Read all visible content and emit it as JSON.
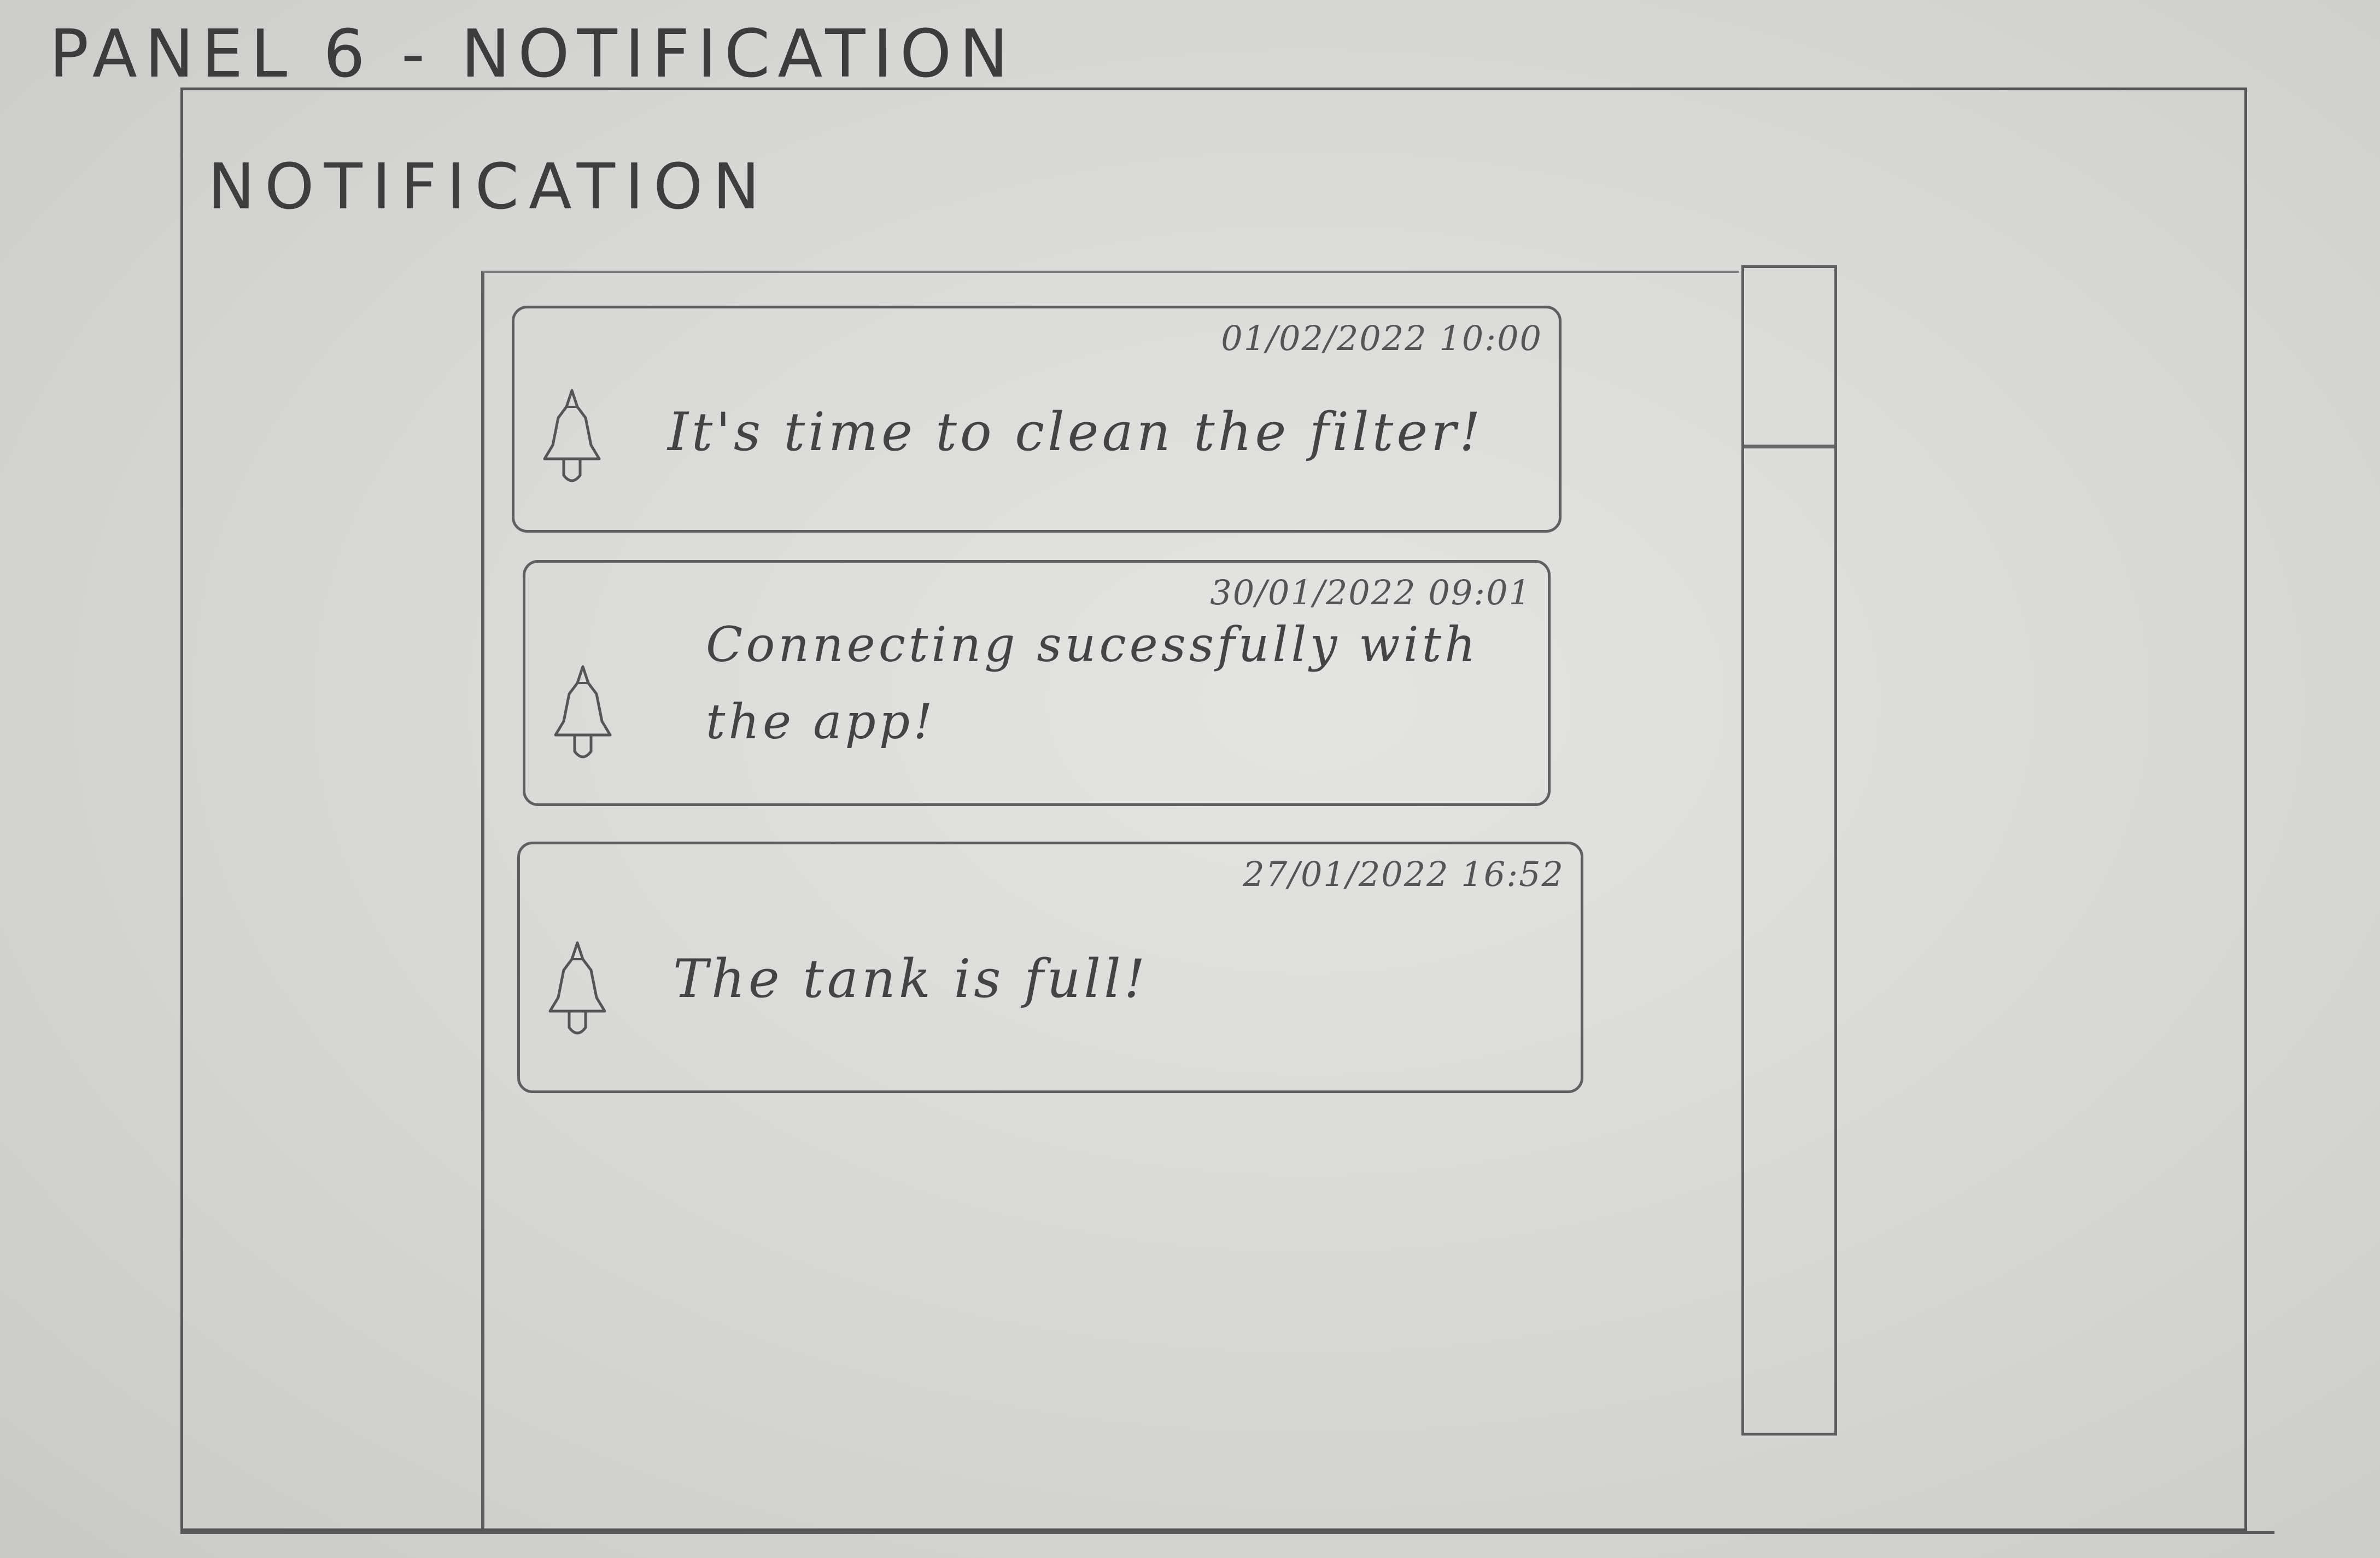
{
  "sketch_title": "PANEL 6 - NOTIFICATION",
  "panel": {
    "heading": "NOTIFICATION"
  },
  "notifications": [
    {
      "timestamp": "01/02/2022 10:00",
      "message": "It's time to clean the filter!",
      "icon": "bell-icon"
    },
    {
      "timestamp": "30/01/2022 09:01",
      "message": "Connecting sucessfully with the app!",
      "icon": "bell-icon"
    },
    {
      "timestamp": "27/01/2022 16:52",
      "message": "The tank is full!",
      "icon": "bell-icon"
    }
  ],
  "colors": {
    "paper": "#d9d9d7",
    "pencil": "#555555"
  }
}
